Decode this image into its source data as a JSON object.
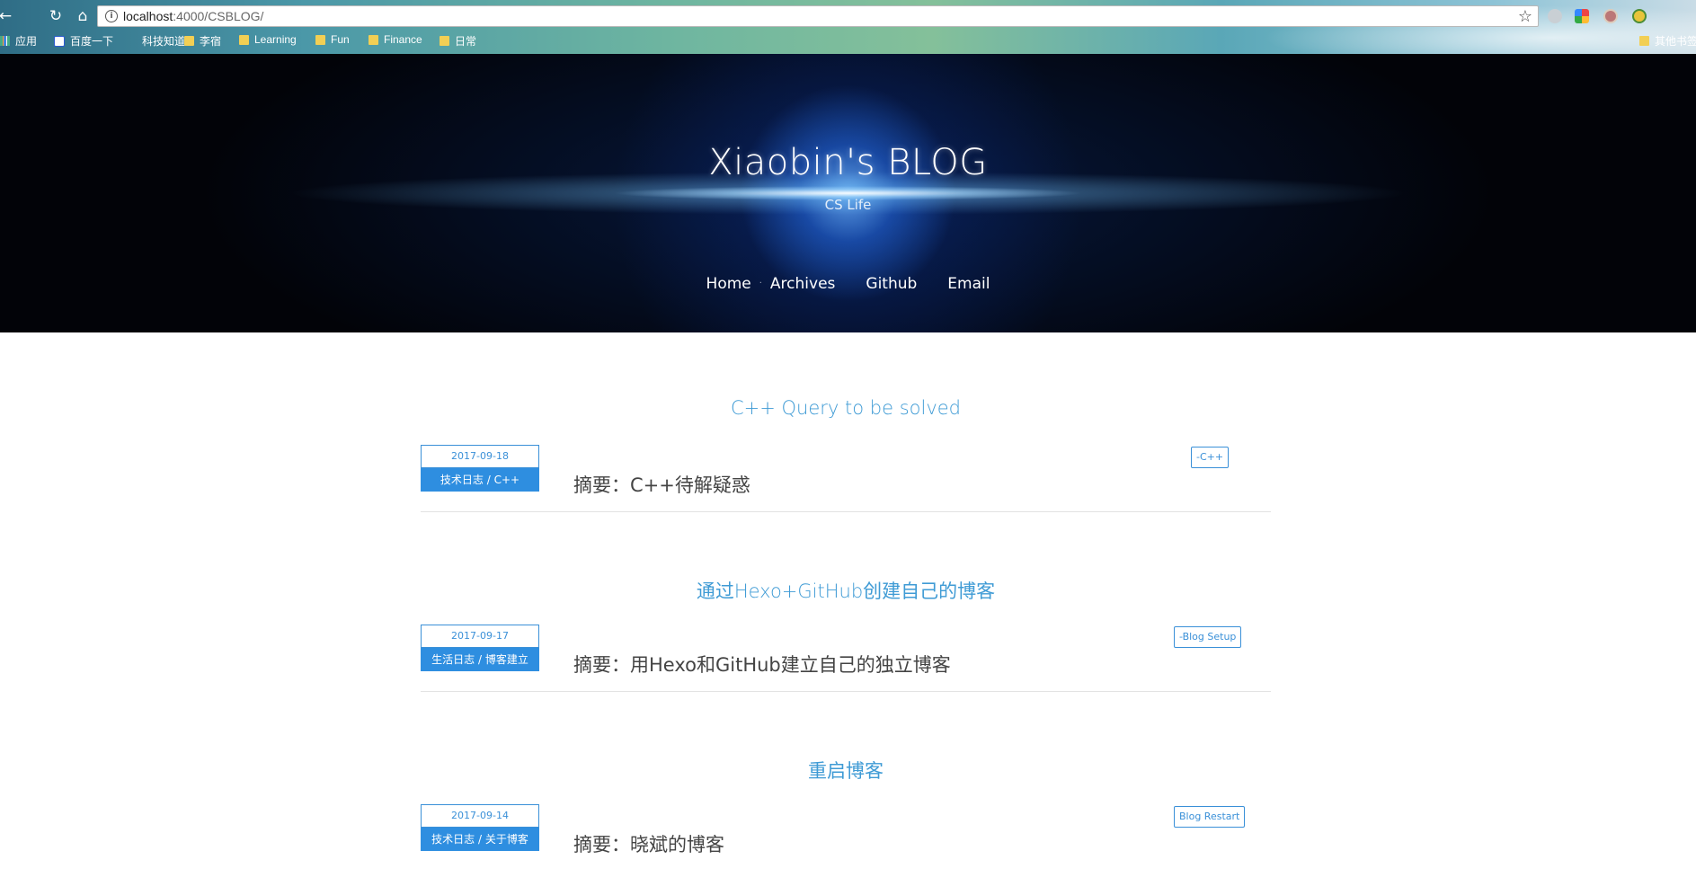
{
  "browser": {
    "url_host": "localhost",
    "url_rest": ":4000/CSBLOG/",
    "bookmarks": [
      "应用",
      "百度一下",
      "科技知道",
      "李宿",
      "Learning",
      "Fun",
      "Finance",
      "日常",
      "其他书签"
    ]
  },
  "site": {
    "title": "Xiaobin's BLOG",
    "subtitle": "CS Life",
    "nav": [
      "Home",
      "Archives",
      "Github",
      "Email"
    ]
  },
  "posts": [
    {
      "title": "C++ Query to be solved",
      "date": "2017-09-18",
      "category": "技术日志 / C++",
      "summary": "摘要：C++待解疑惑",
      "tag": "-C++"
    },
    {
      "title": "通过Hexo+GitHub创建自己的博客",
      "date": "2017-09-17",
      "category": "生活日志 / 博客建立",
      "summary": "摘要：用Hexo和GitHub建立自己的独立博客",
      "tag": "-Blog Setup"
    },
    {
      "title": "重启博客",
      "date": "2017-09-14",
      "category": "技术日志 / 关于博客",
      "summary": "摘要：晓斌的博客",
      "tag": "Blog Restart"
    }
  ],
  "colors": {
    "accent": "#3a90d8",
    "title_blue": "#3f9bd5"
  }
}
